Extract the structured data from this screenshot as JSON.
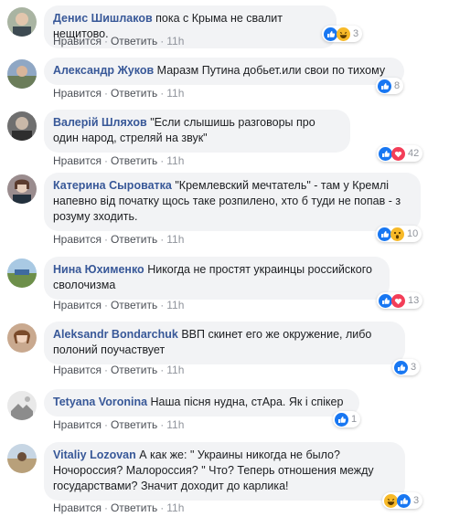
{
  "labels": {
    "like": "Нравится",
    "reply": "Ответить",
    "dot": "·"
  },
  "colors": {
    "author": "#385898",
    "bubble": "#f2f3f5",
    "like_blue": "#1877f2",
    "love_red": "#f33e58",
    "haha_yellow": "#f7b928"
  },
  "comments": [
    {
      "author": "Денис Шишлаков",
      "text": "пока с Крыма не свалит нещитово.",
      "time": "11h",
      "count": "3",
      "reactions": [
        "like-icon",
        "haha-icon"
      ]
    },
    {
      "author": "Александр Жуков",
      "text": "Маразм Путина добьет.или свои по тихому",
      "time": "11h",
      "count": "8",
      "reactions": [
        "like-icon"
      ]
    },
    {
      "author": "Валерій Шляхов",
      "text": "\"Если слышишь разговоры про один народ, стреляй на звук\"",
      "time": "11h",
      "count": "42",
      "reactions": [
        "like-icon",
        "love-icon"
      ]
    },
    {
      "author": "Катерина Сыроватка",
      "text": "\"Кремлевский мечтатель\" - там у Кремлі напевно від початку щось таке розпилено, хто б туди не попав - з розуму зходить.",
      "time": "11h",
      "count": "10",
      "reactions": [
        "like-icon",
        "wow-icon"
      ]
    },
    {
      "author": "Нина Юхименко",
      "text": "Никогда не простят украинцы российского сволочизма",
      "time": "11h",
      "count": "13",
      "reactions": [
        "like-icon",
        "love-icon"
      ]
    },
    {
      "author": "Aleksandr Bondarchuk",
      "text": "ВВП скинет его же окружение, либо полоний поучаствует",
      "time": "11h",
      "count": "3",
      "reactions": [
        "like-icon"
      ]
    },
    {
      "author": "Tetyana Voronina",
      "text": "Наша пісня нудна, стАра. Як і спікер",
      "time": "11h",
      "count": "1",
      "reactions": [
        "like-icon"
      ]
    },
    {
      "author": "Vitaliy Lozovan",
      "text": "А как же: \" Украины никогда не было? Ночороссия? Малороссия? \" Что? Теперь отношения между государствами? Значит доходит до карлика!",
      "time": "11h",
      "count": "3",
      "reactions": [
        "haha-icon",
        "like-icon"
      ]
    }
  ]
}
